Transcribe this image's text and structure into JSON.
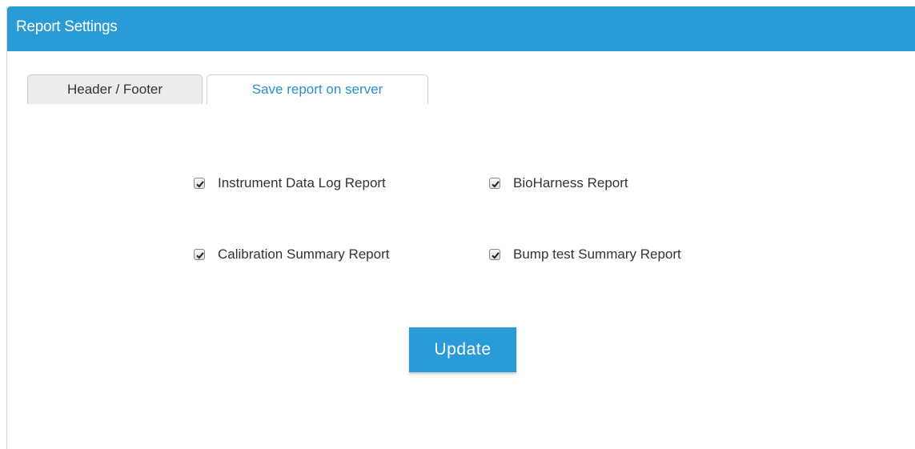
{
  "panel": {
    "title": "Report Settings",
    "header_color": "#2a9bd6"
  },
  "tabs": [
    {
      "label": "Header / Footer",
      "active": false
    },
    {
      "label": "Save report on server",
      "active": true
    }
  ],
  "options": [
    {
      "label": "Instrument Data Log Report",
      "checked": true
    },
    {
      "label": "BioHarness Report",
      "checked": true
    },
    {
      "label": "Calibration Summary Report",
      "checked": true
    },
    {
      "label": "Bump test Summary Report",
      "checked": true
    }
  ],
  "actions": {
    "update_label": "Update"
  }
}
